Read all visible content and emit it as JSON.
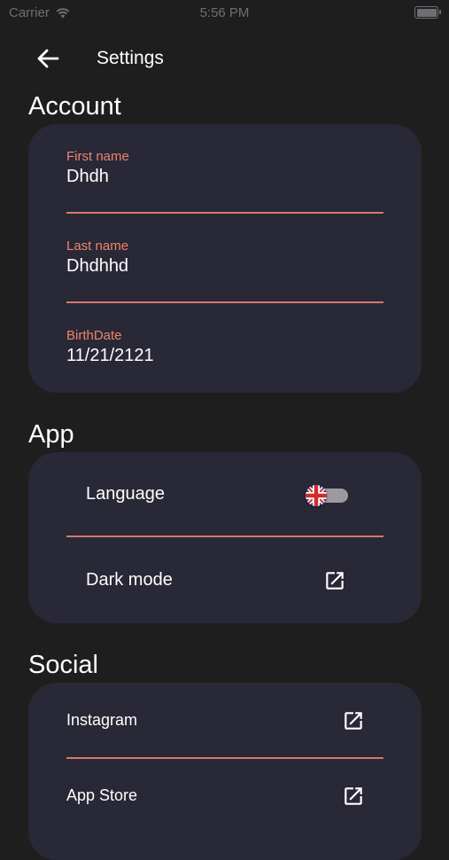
{
  "status_bar": {
    "carrier": "Carrier",
    "time": "5:56 PM"
  },
  "header": {
    "title": "Settings"
  },
  "account": {
    "title": "Account",
    "first_name": {
      "label": "First name",
      "value": "Dhdh"
    },
    "last_name": {
      "label": "Last name",
      "value": "Dhdhhd"
    },
    "birth_date": {
      "label": "BirthDate",
      "value": "11/21/2121"
    }
  },
  "app": {
    "title": "App",
    "language": {
      "label": "Language",
      "icon": "uk-flag-toggle"
    },
    "dark_mode": {
      "label": "Dark mode",
      "icon": "open-in-new-icon"
    }
  },
  "social": {
    "title": "Social",
    "instagram": {
      "label": "Instagram",
      "icon": "open-in-new-icon"
    },
    "app_store": {
      "label": "App Store",
      "icon": "open-in-new-icon"
    }
  },
  "colors": {
    "background": "#1e1e1f",
    "card": "#282836",
    "accent": "#f0836d",
    "divider": "#d9776a"
  }
}
